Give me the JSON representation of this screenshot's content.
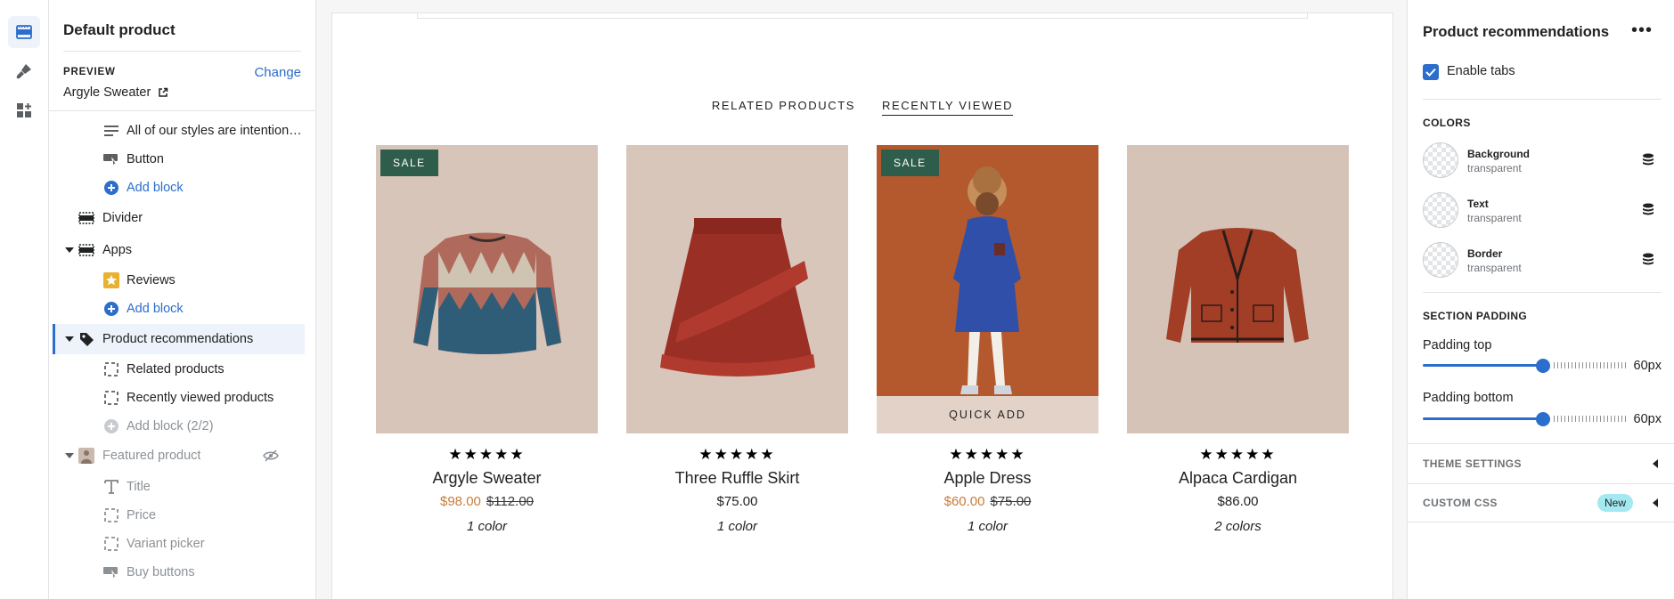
{
  "sidebar": {
    "title": "Default product",
    "preview_label": "PREVIEW",
    "change_label": "Change",
    "preview_value": "Argyle Sweater",
    "tree": [
      {
        "label": "All of our styles are intention…",
        "icon": "text-lines-icon"
      },
      {
        "label": "Button",
        "icon": "button-icon"
      },
      {
        "label": "Add block",
        "icon": "plus-circle-icon"
      },
      {
        "label": "Divider",
        "icon": "section-icon"
      },
      {
        "label": "Apps",
        "icon": "section-icon"
      },
      {
        "label": "Reviews",
        "icon": "star-app-icon"
      },
      {
        "label": "Add block",
        "icon": "plus-circle-icon"
      },
      {
        "label": "Product recommendations",
        "icon": "tag-icon"
      },
      {
        "label": "Related products",
        "icon": "dashed-square-icon"
      },
      {
        "label": "Recently viewed products",
        "icon": "dashed-square-icon"
      },
      {
        "label": "Add block (2/2)",
        "icon": "plus-circle-icon"
      },
      {
        "label": "Featured product",
        "icon": "avatar-icon"
      },
      {
        "label": "Title",
        "icon": "title-icon"
      },
      {
        "label": "Price",
        "icon": "dashed-square-icon"
      },
      {
        "label": "Variant picker",
        "icon": "dashed-square-icon"
      },
      {
        "label": "Buy buttons",
        "icon": "button-icon"
      }
    ]
  },
  "preview": {
    "tabs": [
      {
        "label": "RELATED PRODUCTS",
        "active": false
      },
      {
        "label": "RECENTLY VIEWED",
        "active": true
      }
    ],
    "sale_badge": "SALE",
    "quick_add": "QUICK ADD",
    "stars": "★★★★★",
    "products": [
      {
        "name": "Argyle Sweater",
        "price": "$98.00",
        "compare_price": "$112.00",
        "colors": "1 color",
        "on_sale": true,
        "bg": "#d8c5b9"
      },
      {
        "name": "Three Ruffle Skirt",
        "price": "$75.00",
        "compare_price": "",
        "colors": "1 color",
        "on_sale": false,
        "bg": "#d8c6bb"
      },
      {
        "name": "Apple Dress",
        "price": "$60.00",
        "compare_price": "$75.00",
        "colors": "1 color",
        "on_sale": true,
        "bg": "#b4592e"
      },
      {
        "name": "Alpaca Cardigan",
        "price": "$86.00",
        "compare_price": "",
        "colors": "2 colors",
        "on_sale": false,
        "bg": "#d6c3b8"
      }
    ]
  },
  "settings": {
    "title": "Product recommendations",
    "enable_tabs_label": "Enable tabs",
    "enable_tabs_checked": true,
    "colors_heading": "COLORS",
    "colors": [
      {
        "name": "Background",
        "value": "transparent"
      },
      {
        "name": "Text",
        "value": "transparent"
      },
      {
        "name": "Border",
        "value": "transparent"
      }
    ],
    "padding_heading": "SECTION PADDING",
    "padding_top": {
      "label": "Padding top",
      "value": "60px",
      "fraction": 0.6
    },
    "padding_bottom": {
      "label": "Padding bottom",
      "value": "60px",
      "fraction": 0.6
    },
    "theme_settings": "THEME SETTINGS",
    "custom_css": "CUSTOM CSS",
    "new_badge": "New"
  },
  "colors": {
    "accent": "#2c6ecb",
    "sale_badge": "#2f5d4c",
    "sale_price": "#c87c39"
  }
}
